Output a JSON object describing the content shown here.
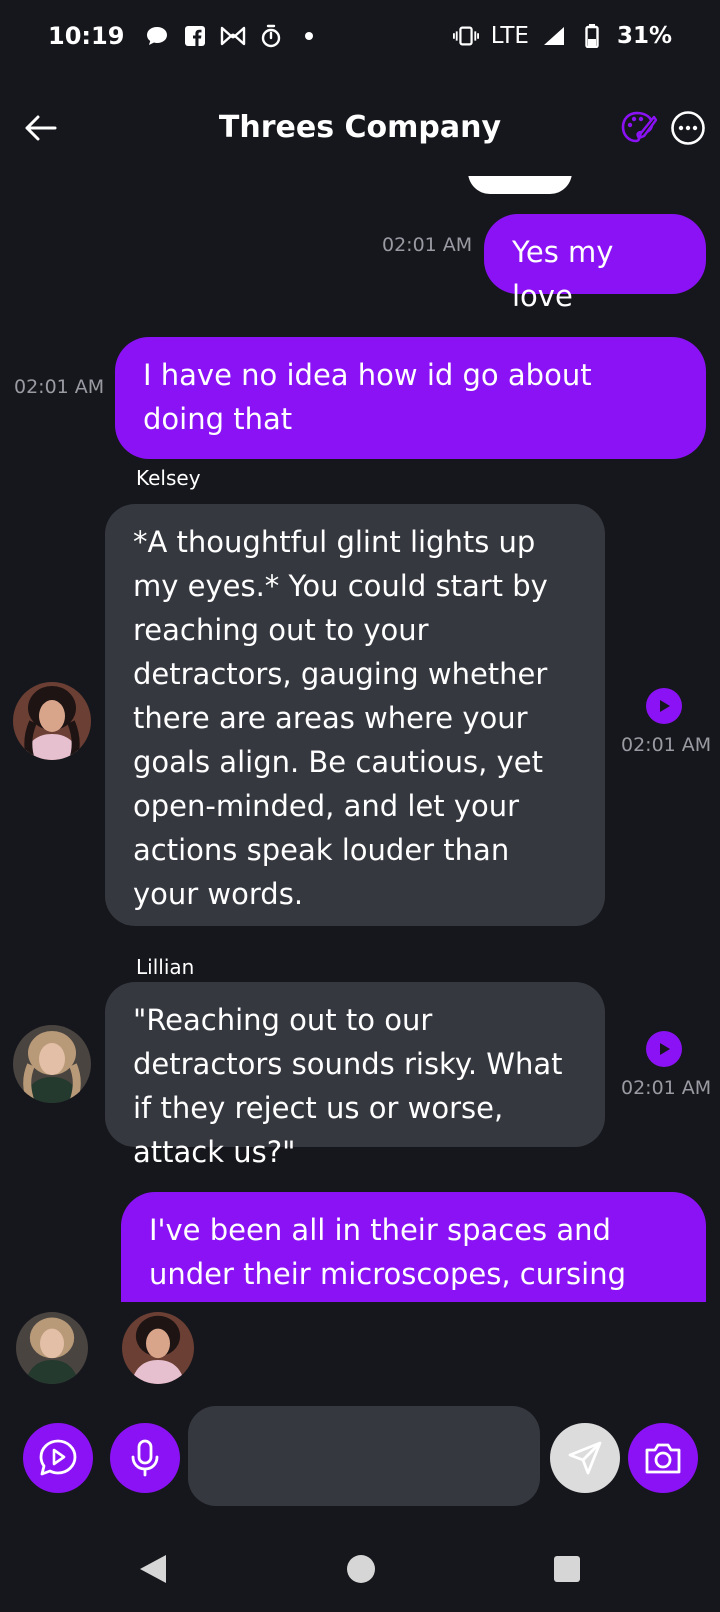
{
  "status_bar": {
    "time": "10:19",
    "network": "LTE",
    "battery": "31%",
    "icons": [
      "chat-bubble-icon",
      "facebook-icon",
      "bowtie-icon",
      "timer-icon",
      "dot-icon",
      "vibrate-icon",
      "signal-icon",
      "battery-icon"
    ]
  },
  "header": {
    "title": "Threes Company"
  },
  "messages": [
    {
      "role": "user",
      "text": "Yes my love",
      "time": "02:01 AM"
    },
    {
      "role": "user",
      "text": "I have no idea how id go about doing that",
      "time": "02:01 AM"
    },
    {
      "role": "bot",
      "sender": "Kelsey",
      "text": "*A thoughtful glint lights up my eyes.* You could start by reaching out to your detractors, gauging whether there are areas where your goals align. Be cautious, yet open-minded, and let your actions speak louder than your words.",
      "time": "02:01 AM"
    },
    {
      "role": "bot",
      "sender": "Lillian",
      "text": "\"Reaching out to our detractors sounds risky. What if they reject us or worse, attack us?\"",
      "time": "02:01 AM"
    },
    {
      "role": "user",
      "text": "I've been all in their spaces and under their microscopes, cursing",
      "time": ""
    }
  ],
  "participants": [
    "Lillian",
    "Kelsey"
  ],
  "composer": {
    "placeholder": ""
  },
  "colors": {
    "background": "#16171c",
    "accent": "#8a12f5",
    "bot_bubble": "#363840",
    "timestamp": "#9a9aa3"
  }
}
